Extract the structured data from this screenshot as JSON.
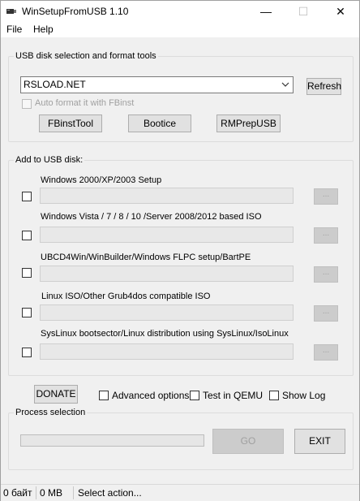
{
  "window": {
    "title": "WinSetupFromUSB 1.10",
    "controls": {
      "minimize": "—",
      "maximize": "☐",
      "close": "✕"
    }
  },
  "menu": {
    "file": "File",
    "help": "Help"
  },
  "usb_group": {
    "label": "USB disk selection and format tools",
    "disk_value": "RSLOAD.NET",
    "refresh": "Refresh",
    "auto_format": "Auto format it with FBinst",
    "fbinsttool": "FBinstTool",
    "bootice": "Bootice",
    "rmprepusb": "RMPrepUSB"
  },
  "add_group": {
    "label": "Add to USB disk:",
    "browse_label": "...",
    "items": [
      {
        "label": "Windows 2000/XP/2003 Setup"
      },
      {
        "label": "Windows Vista / 7 / 8 / 10 /Server 2008/2012 based ISO"
      },
      {
        "label": "UBCD4Win/WinBuilder/Windows FLPC setup/BartPE"
      },
      {
        "label": "Linux ISO/Other Grub4dos compatible ISO"
      },
      {
        "label": "SysLinux bootsector/Linux distribution using SysLinux/IsoLinux"
      }
    ]
  },
  "options": {
    "donate": "DONATE",
    "advanced": "Advanced options",
    "test_qemu": "Test in QEMU",
    "show_log": "Show Log"
  },
  "process": {
    "label": "Process selection",
    "progress": 0,
    "go": "GO",
    "exit": "EXIT"
  },
  "status": {
    "bytes": "0 байт",
    "mb": "0 MB",
    "message": "Select action..."
  }
}
